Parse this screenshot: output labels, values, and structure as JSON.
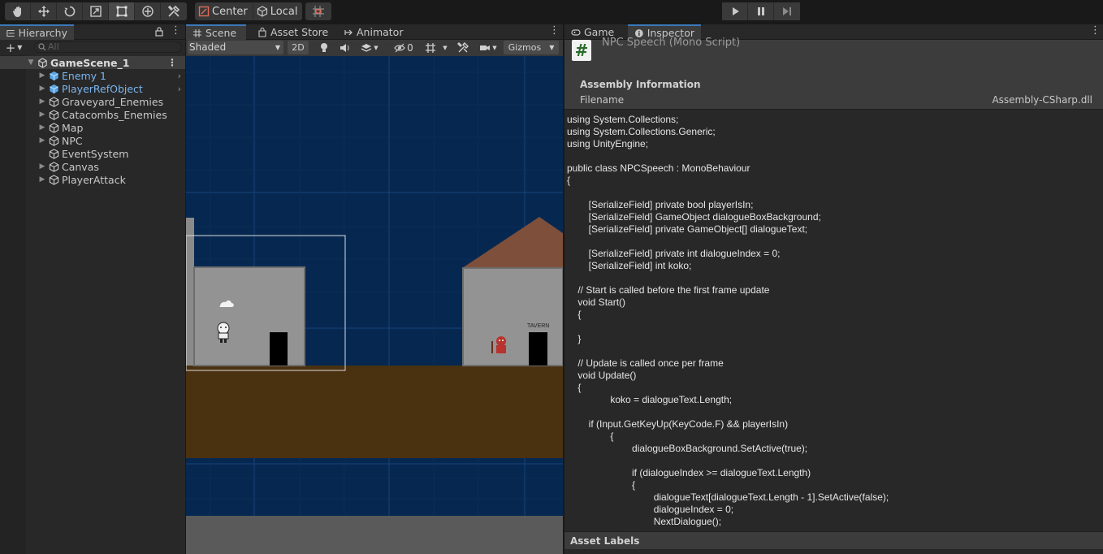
{
  "toolbar": {
    "tools": [
      "hand-tool",
      "move-tool",
      "rotate-tool",
      "scale-tool",
      "rect-tool",
      "transform-tool",
      "custom-tool"
    ],
    "pivot_label": "Center",
    "space_label": "Local"
  },
  "hierarchy": {
    "tab_label": "Hierarchy",
    "search_placeholder": "All",
    "scene_name": "GameScene_1",
    "items": [
      {
        "label": "Enemy 1",
        "prefab": true,
        "expandable": true
      },
      {
        "label": "PlayerRefObject",
        "prefab": true,
        "expandable": true
      },
      {
        "label": "Graveyard_Enemies",
        "prefab": false,
        "expandable": true
      },
      {
        "label": "Catacombs_Enemies",
        "prefab": false,
        "expandable": true
      },
      {
        "label": "Map",
        "prefab": false,
        "expandable": true
      },
      {
        "label": "NPC",
        "prefab": false,
        "expandable": true
      },
      {
        "label": "EventSystem",
        "prefab": false,
        "expandable": false
      },
      {
        "label": "Canvas",
        "prefab": false,
        "expandable": true
      },
      {
        "label": "PlayerAttack",
        "prefab": false,
        "expandable": true
      }
    ]
  },
  "scene": {
    "tabs": [
      "Scene",
      "Asset Store",
      "Animator"
    ],
    "shading_mode": "Shaded",
    "mode_2d": "2D",
    "hidden_count": "0",
    "gizmos_label": "Gizmos",
    "tavern_sign": "TAVERN"
  },
  "inspector": {
    "tabs": [
      "Game",
      "Inspector"
    ],
    "title": "NPC Speech (Mono Script)",
    "assembly_title": "Assembly Information",
    "filename_label": "Filename",
    "filename_value": "Assembly-CSharp.dll",
    "code_lines": [
      "using System.Collections;",
      "using System.Collections.Generic;",
      "using UnityEngine;",
      "",
      "public class NPCSpeech : MonoBehaviour",
      "{",
      "",
      "\t[SerializeField] private bool playerIsIn;",
      "\t[SerializeField] GameObject dialogueBoxBackground;",
      "\t[SerializeField] private GameObject[] dialogueText;",
      "",
      "\t[SerializeField] private int dialogueIndex = 0;",
      "\t[SerializeField] int koko;",
      "",
      "    // Start is called before the first frame update",
      "    void Start()",
      "    {",
      "",
      "    }",
      "",
      "    // Update is called once per frame",
      "    void Update()",
      "    {",
      "\t\tkoko = dialogueText.Length;",
      "",
      "        if (Input.GetKeyUp(KeyCode.F) && playerIsIn)",
      "\t\t{",
      "\t\t\tdialogueBoxBackground.SetActive(true);",
      "",
      "\t\t\tif (dialogueIndex >= dialogueText.Length)",
      "\t\t\t{",
      "\t\t\t\tdialogueText[dialogueText.Length - 1].SetActive(false);",
      "\t\t\t\tdialogueIndex = 0;",
      "\t\t\t\tNextDialogue();"
    ],
    "labels_title": "Asset Labels"
  },
  "colors": {
    "accent": "#3a79bb",
    "prefab_text": "#7ab5ee",
    "scene_bg": "#062850",
    "ground": "#4a3110"
  }
}
